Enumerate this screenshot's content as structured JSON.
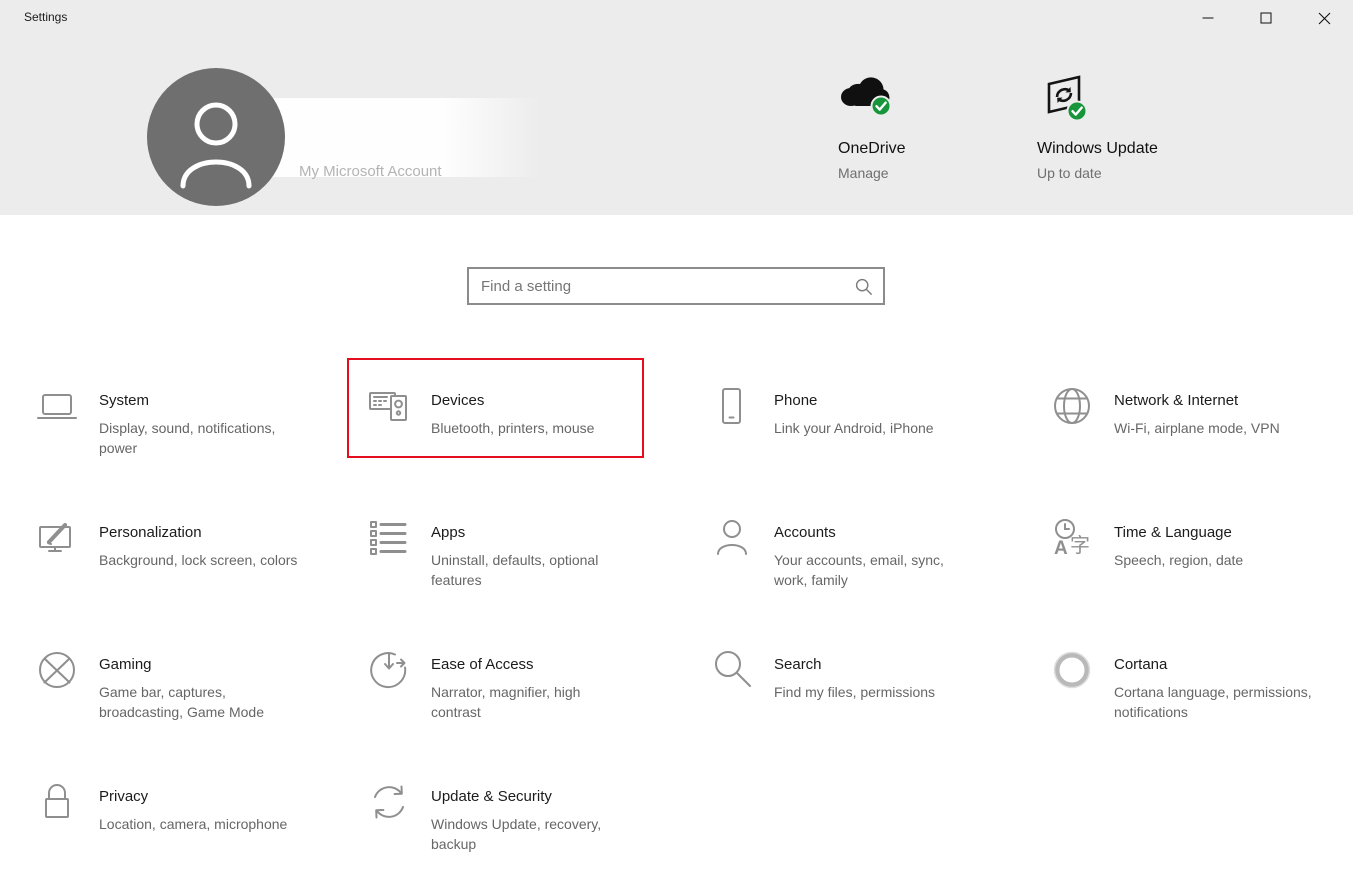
{
  "window": {
    "title": "Settings"
  },
  "titlebar": {
    "buttons": [
      "minimize",
      "maximize",
      "close"
    ]
  },
  "header": {
    "account_label": "My Microsoft Account",
    "quick_status": [
      {
        "title": "OneDrive",
        "status": "Manage",
        "icon": "onedrive-cloud-icon"
      },
      {
        "title": "Windows Update",
        "status": "Up to date",
        "icon": "windows-update-icon"
      }
    ]
  },
  "search": {
    "placeholder": "Find a setting",
    "icon": "search-icon"
  },
  "tiles": [
    {
      "title": "System",
      "subtitle": "Display, sound, notifications,\npower",
      "icon": "laptop-icon",
      "highlighted": false
    },
    {
      "title": "Devices",
      "subtitle": "Bluetooth, printers, mouse",
      "icon": "devices-icon",
      "highlighted": true
    },
    {
      "title": "Phone",
      "subtitle": "Link your Android, iPhone",
      "icon": "phone-icon",
      "highlighted": false
    },
    {
      "title": "Network & Internet",
      "subtitle": "Wi-Fi, airplane mode, VPN",
      "icon": "globe-icon",
      "highlighted": false
    },
    {
      "title": "Personalization",
      "subtitle": "Background, lock screen, colors",
      "icon": "personalization-icon",
      "highlighted": false
    },
    {
      "title": "Apps",
      "subtitle": "Uninstall, defaults, optional\nfeatures",
      "icon": "apps-list-icon",
      "highlighted": false
    },
    {
      "title": "Accounts",
      "subtitle": "Your accounts, email, sync,\nwork, family",
      "icon": "person-icon",
      "highlighted": false
    },
    {
      "title": "Time & Language",
      "subtitle": "Speech, region, date",
      "icon": "time-language-icon",
      "highlighted": false
    },
    {
      "title": "Gaming",
      "subtitle": "Game bar, captures,\nbroadcasting, Game Mode",
      "icon": "xbox-icon",
      "highlighted": false
    },
    {
      "title": "Ease of Access",
      "subtitle": "Narrator, magnifier, high\ncontrast",
      "icon": "ease-of-access-icon",
      "highlighted": false
    },
    {
      "title": "Search",
      "subtitle": "Find my files, permissions",
      "icon": "magnifier-icon",
      "highlighted": false
    },
    {
      "title": "Cortana",
      "subtitle": "Cortana language, permissions,\nnotifications",
      "icon": "cortana-ring-icon",
      "highlighted": false
    },
    {
      "title": "Privacy",
      "subtitle": "Location, camera, microphone",
      "icon": "lock-icon",
      "highlighted": false
    },
    {
      "title": "Update & Security",
      "subtitle": "Windows Update, recovery,\nbackup",
      "icon": "sync-arrows-icon",
      "highlighted": false
    }
  ],
  "colors": {
    "highlight_red": "#e30f1e",
    "status_green": "#17953b",
    "header_bg": "#ececec",
    "icon_gray": "#8f8f8f"
  }
}
